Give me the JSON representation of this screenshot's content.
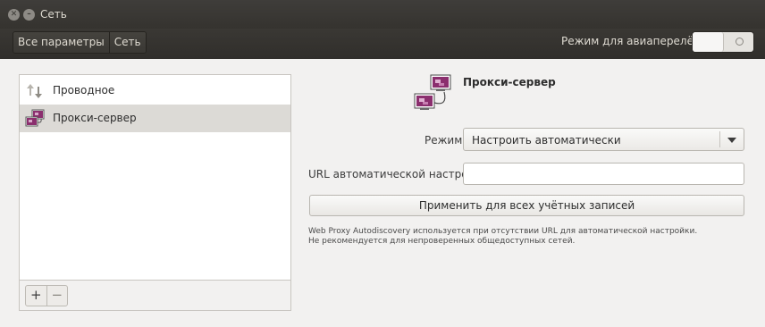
{
  "window": {
    "title": "Сеть"
  },
  "toolbar": {
    "breadcrumbs": [
      "Все параметры",
      "Сеть"
    ],
    "airplane_label": "Режим для авиаперелётов",
    "airplane_mode_on": false
  },
  "sidebar": {
    "items": [
      {
        "label": "Проводное",
        "icon": "wired-network-icon",
        "selected": false
      },
      {
        "label": "Прокси-сервер",
        "icon": "proxy-icon",
        "selected": true
      }
    ],
    "add_glyph": "+",
    "remove_glyph": "−"
  },
  "proxy": {
    "title": "Прокси-сервер",
    "mode_label": "Режим",
    "mode_value": "Настроить автоматически",
    "url_label": "URL автоматической настройки",
    "url_value": "",
    "apply_label": "Применить для всех учётных записей",
    "note_line1": "Web Proxy Autodiscovery используется при отсутствии URL для автоматической настройки.",
    "note_line2": "Не рекомендуется для непроверенных общедоступных сетей."
  },
  "colors": {
    "accent_purple": "#8b2f6e",
    "selected_row": "#dcdad6",
    "titlebar": "#3c3b37"
  }
}
